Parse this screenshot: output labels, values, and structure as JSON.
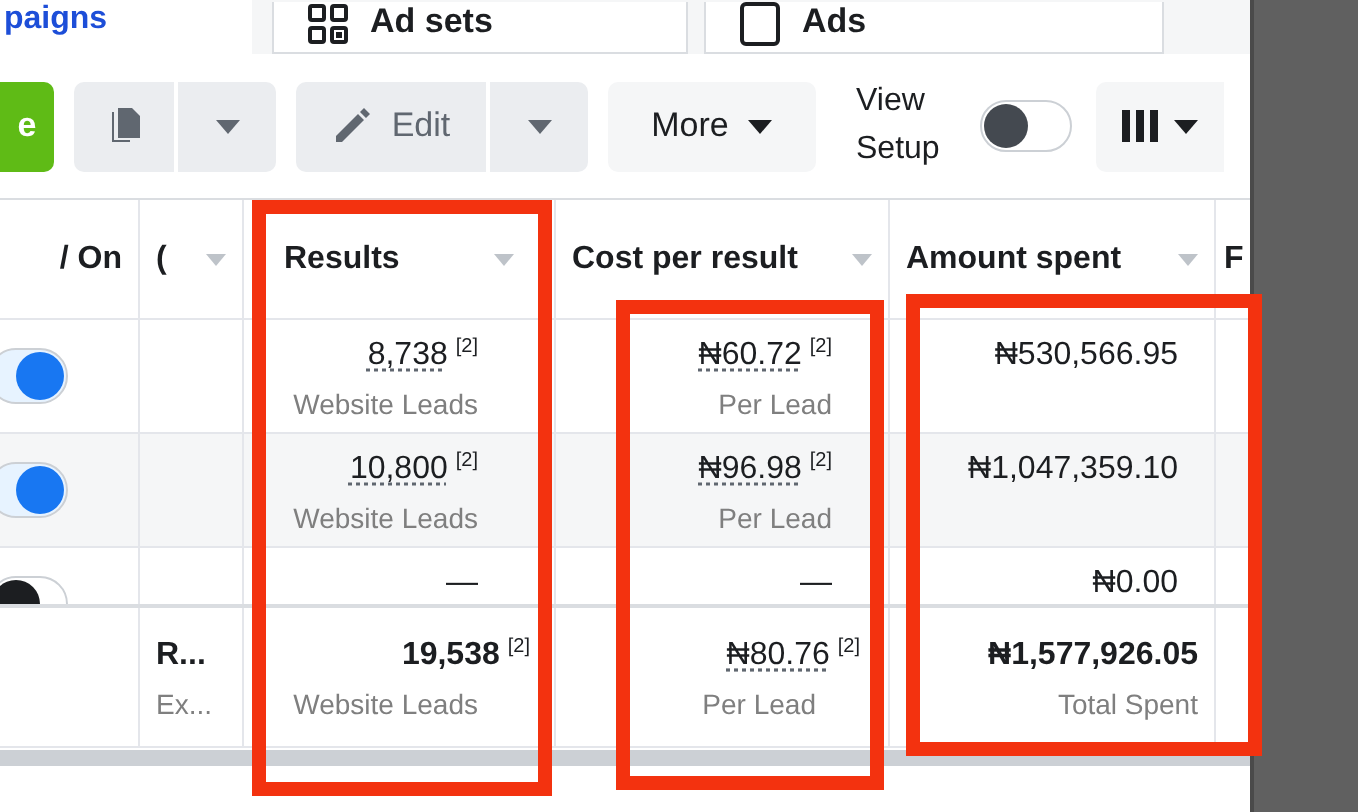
{
  "tabs": [
    {
      "label": "paigns",
      "kind": "link"
    },
    {
      "label": "Ad sets",
      "kind": "grid"
    },
    {
      "label": "Ads",
      "kind": "box"
    }
  ],
  "toolbar": {
    "create_label": "e",
    "edit_label": "Edit",
    "more_label": "More",
    "view_setup_label": "View Setup",
    "view_setup_on": false
  },
  "annotations": [
    {
      "kind": "frame"
    },
    {
      "kind": "frame"
    },
    {
      "kind": "frame"
    }
  ],
  "table": {
    "columns": [
      {
        "label": "/ On",
        "sortable": false
      },
      {
        "label": "(",
        "sortable": true
      },
      {
        "label": "Results",
        "sortable": true
      },
      {
        "label": "Cost per result",
        "sortable": true
      },
      {
        "label": "Amount spent",
        "sortable": true
      },
      {
        "label": "F",
        "sortable": false
      }
    ],
    "rows": [
      {
        "on": true,
        "results": {
          "value": "8,738",
          "note": "[2]",
          "label": "Website Leads"
        },
        "cost": {
          "value": "₦60.72",
          "note": "[2]",
          "label": "Per Lead"
        },
        "spent": "₦530,566.95"
      },
      {
        "on": true,
        "results": {
          "value": "10,800",
          "note": "[2]",
          "label": "Website Leads"
        },
        "cost": {
          "value": "₦96.98",
          "note": "[2]",
          "label": "Per Lead"
        },
        "spent": "₦1,047,359.10"
      },
      {
        "on": false,
        "results": {
          "value": "—"
        },
        "cost": {
          "value": "—"
        },
        "spent": "₦0.00"
      }
    ],
    "summary": {
      "name": "R...",
      "name_sub": "Ex...",
      "results": {
        "value": "19,538",
        "note": "[2]",
        "label": "Website Leads"
      },
      "cost": {
        "value": "₦80.76",
        "note": "[2]",
        "label": "Per Lead"
      },
      "spent": "₦1,577,926.05",
      "spent_label": "Total Spent"
    }
  }
}
